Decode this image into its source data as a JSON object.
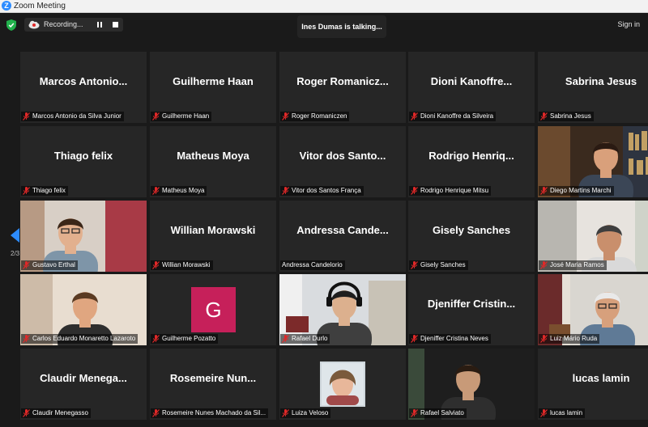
{
  "window": {
    "title": "Zoom Meeting",
    "logo_letter": "Z"
  },
  "topbar": {
    "recording_label": "Recording...",
    "active_speaker": "Ines Dumas is talking...",
    "signin_label": "Sign in"
  },
  "pager": {
    "text": "2/3"
  },
  "colors": {
    "accent": "#2d8cff",
    "mic_muted": "#e02828",
    "shield": "#22b14c",
    "tile_bg": "#262626",
    "avatar_g": "#c6205a"
  },
  "tiles": [
    {
      "name": "Marcos Antonio...",
      "label": "Marcos Antonio da Silva Junior",
      "muted": true
    },
    {
      "name": "Guilherme Haan",
      "label": "Guilherme Haan",
      "muted": true
    },
    {
      "name": "Roger Romanicz...",
      "label": "Roger Romaniczen",
      "muted": true
    },
    {
      "name": "Dioni Kanoffre...",
      "label": "Dioni Kanoffre da Silveira",
      "muted": true
    },
    {
      "name": "Sabrina Jesus",
      "label": "Sabrina Jesus",
      "muted": true
    },
    {
      "name": "Thiago felix",
      "label": "Thiago felix",
      "muted": true
    },
    {
      "name": "Matheus Moya",
      "label": "Matheus Moya",
      "muted": true
    },
    {
      "name": "Vitor dos Santo...",
      "label": "Vitor dos Santos França",
      "muted": true
    },
    {
      "name": "Rodrigo Henriq...",
      "label": "Rodrigo Henrique Mitsu",
      "muted": true
    },
    {
      "name": "",
      "label": "Diego Martins Marchi",
      "muted": true
    },
    {
      "name": "",
      "label": "Gustavo Erthal",
      "muted": true
    },
    {
      "name": "Willian Morawski",
      "label": "Willian Morawski",
      "muted": true
    },
    {
      "name": "Andressa Cande...",
      "label": "Andressa Candelorio",
      "muted": false
    },
    {
      "name": "Gisely Sanches",
      "label": "Gisely Sanches",
      "muted": true
    },
    {
      "name": "",
      "label": "José Maria Ramos",
      "muted": true
    },
    {
      "name": "",
      "label": "Carlos Eduardo Monaretto Lazaroto",
      "muted": true
    },
    {
      "name": "",
      "label": "Guilherme Pozatto",
      "muted": true,
      "avatar_letter": "G"
    },
    {
      "name": "",
      "label": "Rafael Durlo",
      "muted": true
    },
    {
      "name": "Djeniffer Cristin...",
      "label": "Djeniffer Cristina Neves",
      "muted": true
    },
    {
      "name": "",
      "label": "Luiz Mário Ruda",
      "muted": true
    },
    {
      "name": "Claudir Menega...",
      "label": "Claudir Menegasso",
      "muted": true
    },
    {
      "name": "Rosemeire Nun...",
      "label": "Rosemeire Nunes Machado da Sil...",
      "muted": true
    },
    {
      "name": "",
      "label": "Luiza Veloso",
      "muted": true
    },
    {
      "name": "",
      "label": "Rafael Salviato",
      "muted": true
    },
    {
      "name": "lucas lamin",
      "label": "lucas lamin",
      "muted": true
    }
  ]
}
